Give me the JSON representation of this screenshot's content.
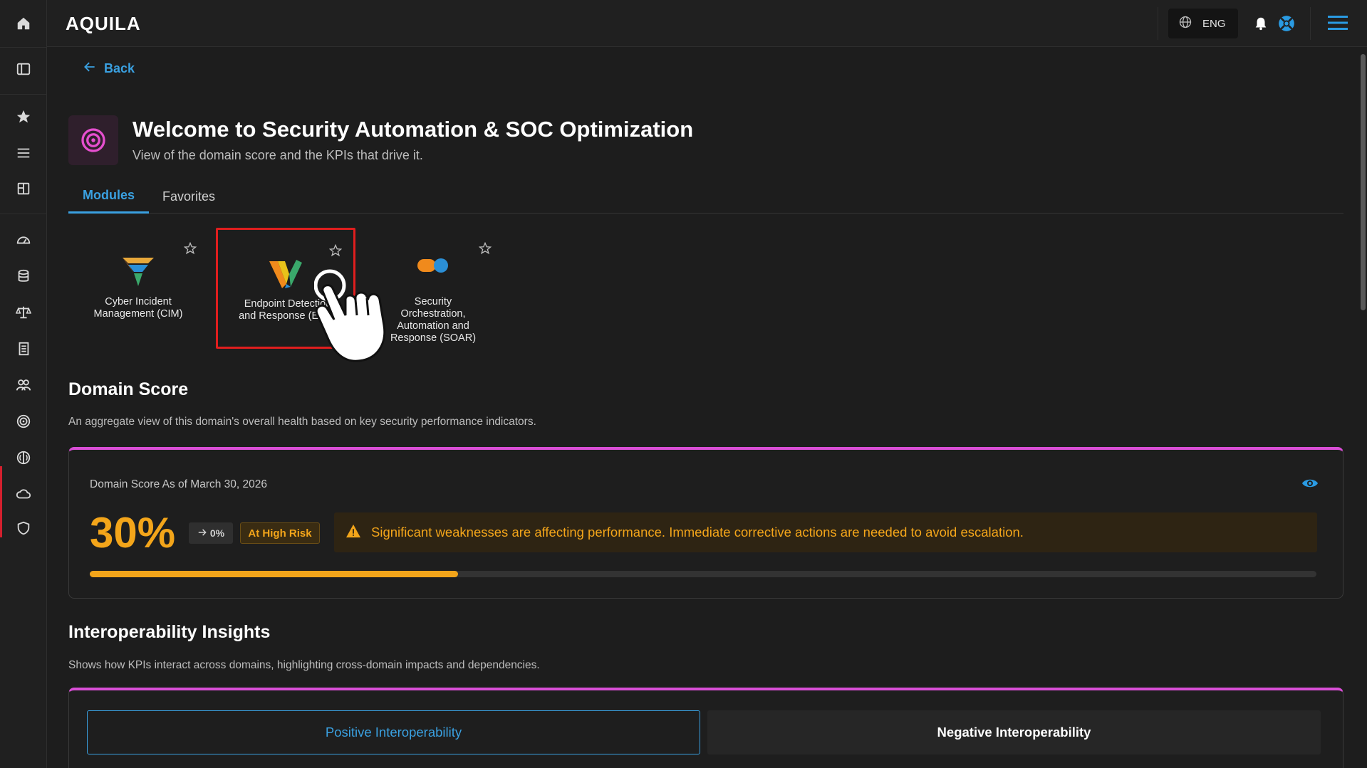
{
  "app": {
    "logo": "AQUILA"
  },
  "topbar": {
    "language": "ENG"
  },
  "nav": {
    "back_label": "Back"
  },
  "hero": {
    "title": "Welcome to Security Automation & SOC Optimization",
    "subtitle": "View of the domain score and the KPIs that drive it."
  },
  "tabs": [
    {
      "label": "Modules",
      "active": true
    },
    {
      "label": "Favorites",
      "active": false
    }
  ],
  "modules": [
    {
      "label": "Cyber Incident\nManagement (CIM)",
      "icon": "cim-logo-icon"
    },
    {
      "label": "Endpoint Detection\nand Response (EDR)",
      "icon": "edr-logo-icon",
      "selected": true
    },
    {
      "label": "Security\nOrchestration,\nAutomation and\nResponse (SOAR)",
      "icon": "soar-logo-icon"
    }
  ],
  "domain_score": {
    "title": "Domain Score",
    "subtitle": "An aggregate view of this domain's overall health based on key security performance indicators.",
    "label": "Domain Score As of March 30, 2026",
    "value": "30%",
    "delta": "0%",
    "risk": "At High Risk",
    "alert": "Significant weaknesses are affecting performance. Immediate corrective actions are needed to avoid escalation.",
    "progress": 0.3
  },
  "interop": {
    "title": "Interoperability Insights",
    "subtitle": "Shows how KPIs interact across domains, highlighting cross-domain impacts and dependencies.",
    "positive_label": "Positive Interoperability",
    "negative_label": "Negative Interoperability"
  },
  "colors": {
    "accent": "#3aa0e0",
    "warning": "#f3a51a",
    "card_top_border": "#d94ed6",
    "selection": "#e01e1e"
  }
}
